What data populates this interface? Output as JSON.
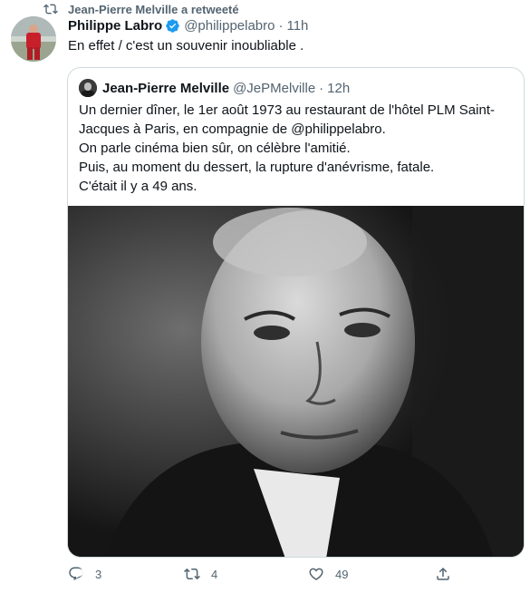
{
  "retweet_header": {
    "text": "Jean-Pierre Melville a retweeté"
  },
  "tweet": {
    "author_name": "Philippe Labro",
    "author_handle": "@philippelabro",
    "separator": "·",
    "time": "11h",
    "text": "En effet / c'est un souvenir inoubliable ."
  },
  "quoted_tweet": {
    "author_name": "Jean-Pierre Melville",
    "author_handle": "@JePMelville",
    "separator": "·",
    "time": "12h",
    "lines": [
      "Un dernier dîner, le 1er août 1973 au restaurant de l'hôtel PLM Saint-",
      "Jacques à Paris, en compagnie de @philippelabro.",
      "On parle cinéma bien sûr, on célèbre l'amitié.",
      "Puis, au moment du dessert, la rupture d'anévrisme, fatale.",
      "C'était il y a 49 ans."
    ]
  },
  "actions": {
    "reply_count": "3",
    "retweet_count": "4",
    "like_count": "49"
  },
  "colors": {
    "text": "#0f1419",
    "secondary": "#536471",
    "border": "#cfd9de",
    "verified": "#1d9bf0"
  },
  "icons": [
    "retweet-icon",
    "verified-badge-icon",
    "reply-icon",
    "like-icon",
    "share-icon"
  ]
}
